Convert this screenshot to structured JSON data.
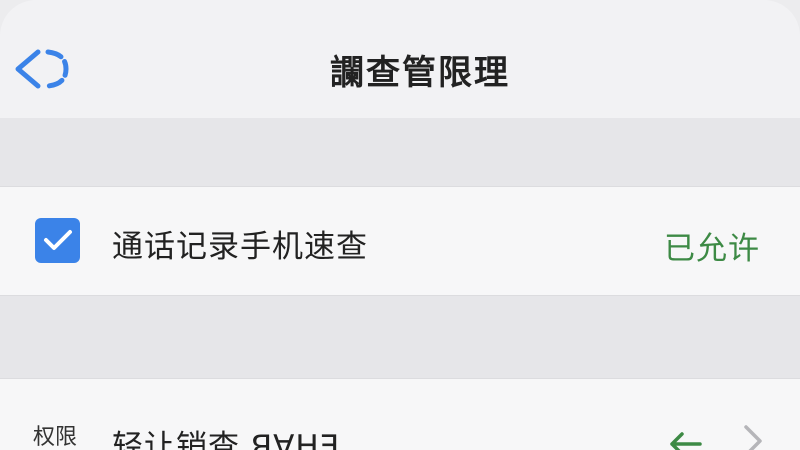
{
  "nav": {
    "title": "讕查管限理",
    "back_icon": "back-chevron-icon"
  },
  "rows": [
    {
      "label": "通话记录手机速查",
      "status": "已允许",
      "checked": true,
      "status_color": "#3d8a45"
    },
    {
      "section_tag": "权限",
      "label": "轻让销查 ꓭ∀HƎ",
      "arrow_icon": "left-arrow-icon",
      "chevron_icon": "chevron-right-icon"
    }
  ],
  "colors": {
    "accent": "#3b83e8",
    "allowed_green": "#3d8a45"
  }
}
